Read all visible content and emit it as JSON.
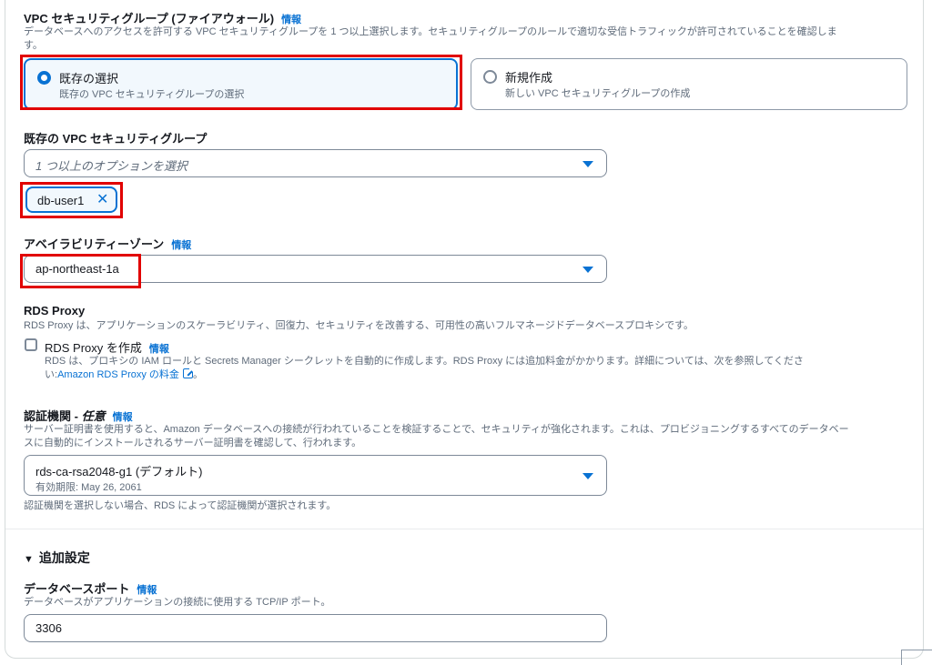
{
  "security_group": {
    "title": "VPC セキュリティグループ (ファイアウォール)",
    "info": "情報",
    "description_line1": "データベースへのアクセスを許可する VPC セキュリティグループを 1 つ以上選択します。セキュリティグループのルールで適切な受信トラフィックが許可されていることを確認しま",
    "description_line2": "す。",
    "option_existing_title": "既存の選択",
    "option_existing_desc": "既存の VPC セキュリティグループの選択",
    "option_new_title": "新規作成",
    "option_new_desc": "新しい VPC セキュリティグループの作成",
    "existing_label": "既存の VPC セキュリティグループ",
    "select_placeholder": "1 つ以上のオプションを選択",
    "selected_token": "db-user1"
  },
  "availability_zone": {
    "label": "アベイラビリティーゾーン",
    "info": "情報",
    "value": "ap-northeast-1a"
  },
  "rds_proxy": {
    "title": "RDS Proxy",
    "description": "RDS Proxy は、アプリケーションのスケーラビリティ、回復力、セキュリティを改善する、可用性の高いフルマネージドデータベースプロキシです。",
    "checkbox_label": "RDS Proxy を作成",
    "info": "情報",
    "checkbox_desc_line1": "RDS は、プロキシの IAM ロールと Secrets Manager シークレットを自動的に作成します。RDS Proxy には追加料金がかかります。詳細については、次を参照してくださ",
    "checkbox_desc_prefix": "い:",
    "pricing_link": "Amazon RDS Proxy の料金",
    "checkbox_desc_suffix": "。"
  },
  "certificate_authority": {
    "label_main": "認証機関 - ",
    "label_optional": "任意",
    "info": "情報",
    "description_line1": "サーバー証明書を使用すると、Amazon データベースへの接続が行われていることを検証することで、セキュリティが強化されます。これは、プロビジョニングするすべてのデータベー",
    "description_line2": "スに自動的にインストールされるサーバー証明書を確認して、行われます。",
    "value": "rds-ca-rsa2048-g1 (デフォルト)",
    "expiry": "有効期限: May 26, 2061",
    "footer": "認証機関を選択しない場合、RDS によって認証機関が選択されます。"
  },
  "additional_settings": {
    "title": "追加設定",
    "port_label": "データベースポート",
    "info": "情報",
    "port_desc": "データベースがアプリケーションの接続に使用する TCP/IP ポート。",
    "port_value": "3306"
  },
  "colors": {
    "accent": "#0972d3",
    "highlight": "#e10000"
  }
}
